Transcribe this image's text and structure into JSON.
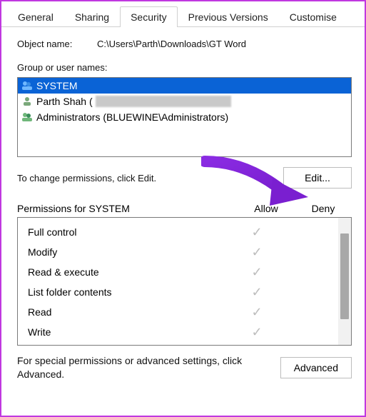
{
  "tabs": {
    "general": "General",
    "sharing": "Sharing",
    "security": "Security",
    "previous": "Previous Versions",
    "customise": "Customise",
    "active": "security"
  },
  "labels": {
    "object_name": "Object name:",
    "object_path": "C:\\Users\\Parth\\Downloads\\GT Word",
    "group_or_user": "Group or user names:",
    "change_perms": "To change permissions, click Edit.",
    "edit_button": "Edit...",
    "perm_header_prefix": "Permissions for ",
    "perm_target": "SYSTEM",
    "allow": "Allow",
    "deny": "Deny",
    "special_perms": "For special permissions or advanced settings, click Advanced.",
    "advanced_button": "Advanced"
  },
  "users": [
    {
      "name": "SYSTEM",
      "selected": true,
      "icon": "group"
    },
    {
      "name": "Parth Shah (",
      "selected": false,
      "icon": "user",
      "redacted_suffix": true
    },
    {
      "name": "Administrators (BLUEWINE\\Administrators)",
      "selected": false,
      "icon": "group"
    }
  ],
  "permissions": [
    {
      "name": "Full control",
      "allow": true,
      "deny": false
    },
    {
      "name": "Modify",
      "allow": true,
      "deny": false
    },
    {
      "name": "Read & execute",
      "allow": true,
      "deny": false
    },
    {
      "name": "List folder contents",
      "allow": true,
      "deny": false
    },
    {
      "name": "Read",
      "allow": true,
      "deny": false
    },
    {
      "name": "Write",
      "allow": true,
      "deny": false
    }
  ],
  "colors": {
    "accent_purple": "#8a2be2",
    "selection_blue": "#0a63d6",
    "border_magenta": "#c038e0"
  }
}
